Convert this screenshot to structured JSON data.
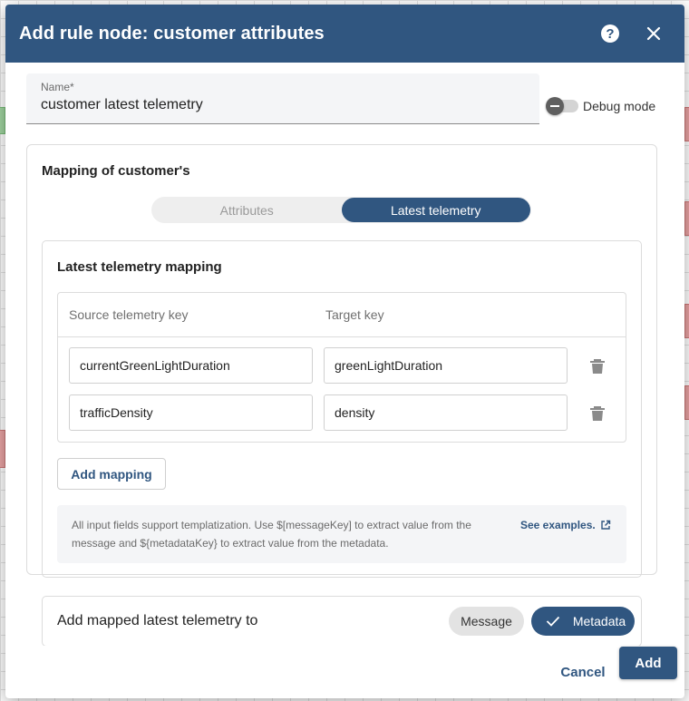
{
  "dialog": {
    "title": "Add rule node: customer attributes",
    "help_icon": "help-icon",
    "close_icon": "close-icon"
  },
  "name_field": {
    "label": "Name*",
    "value": "customer latest telemetry"
  },
  "debug": {
    "label": "Debug mode",
    "enabled": false
  },
  "mapping": {
    "title": "Mapping of customer's",
    "options": [
      "Attributes",
      "Latest telemetry"
    ],
    "selected": "Latest telemetry"
  },
  "telemetry_mapping": {
    "title": "Latest telemetry mapping",
    "columns": [
      "Source telemetry key",
      "Target key"
    ],
    "rows": [
      {
        "source": "currentGreenLightDuration",
        "target": "greenLightDuration"
      },
      {
        "source": "trafficDensity",
        "target": "density"
      }
    ],
    "add_button": "Add mapping",
    "hint": "All input fields support templatization. Use $[messageKey] to extract value from the message and ${metadataKey} to extract value from the metadata.",
    "hint_link": "See examples."
  },
  "add_to": {
    "label": "Add mapped latest telemetry to",
    "options": [
      "Message",
      "Metadata"
    ],
    "selected": "Metadata"
  },
  "footer": {
    "cancel": "Cancel",
    "add": "Add"
  },
  "colors": {
    "primary": "#305680",
    "header_bg": "#305680"
  }
}
